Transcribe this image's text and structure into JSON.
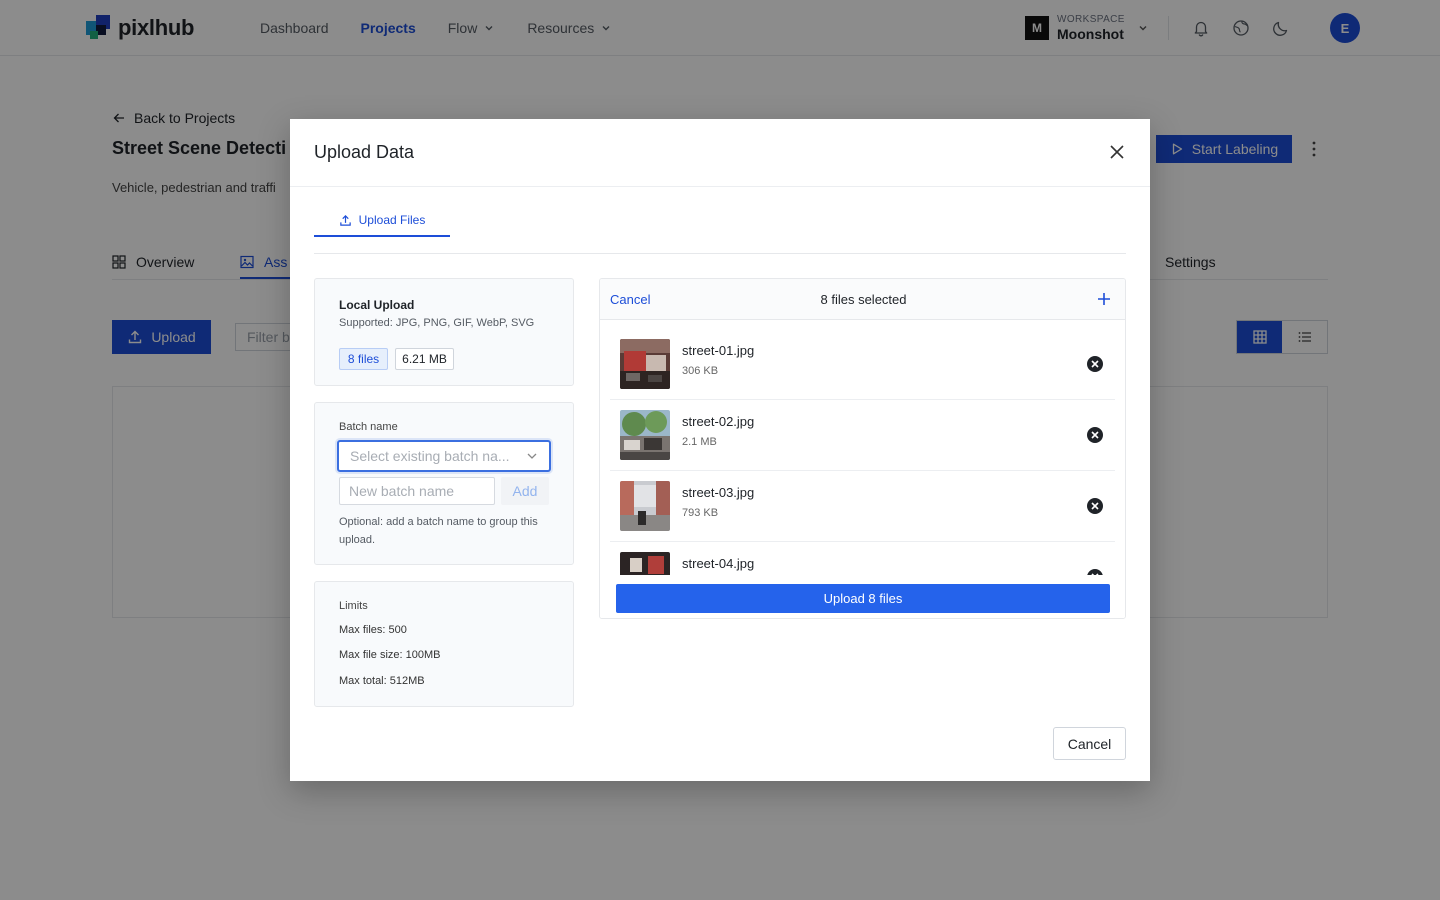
{
  "nav": {
    "brand": "pixlhub",
    "links": [
      {
        "label": "Dashboard"
      },
      {
        "label": "Projects"
      },
      {
        "label": "Flow"
      },
      {
        "label": "Resources"
      }
    ],
    "workspace": {
      "badge": "M",
      "label": "WORKSPACE",
      "name": "Moonshot"
    },
    "icons": [
      "bell-icon",
      "globe-icon",
      "moon-icon"
    ],
    "avatar_initial": "E"
  },
  "page": {
    "back_label": "Back to Projects",
    "title": "Street Scene Detecti",
    "description": "Vehicle, pedestrian and traffi",
    "start_label": "Start Labeling",
    "tabs": {
      "overview": "Overview",
      "assets": "Ass",
      "settings": "Settings"
    },
    "upload_label": "Upload",
    "filter_placeholder": "Filter b"
  },
  "modal": {
    "title": "Upload Data",
    "tab_label": "Upload Files",
    "local": {
      "title": "Local Upload",
      "supported": "Supported: JPG, PNG, GIF, WebP, SVG",
      "files_chip": "8 files",
      "size_chip": "6.21 MB"
    },
    "batch": {
      "label": "Batch name",
      "select_placeholder": "Select existing batch na...",
      "new_placeholder": "New batch name",
      "add_label": "Add",
      "help": "Optional: add a batch name to group this upload."
    },
    "limits": {
      "title": "Limits",
      "max_files": "Max files: 500",
      "max_file_size": "Max file size: 100MB",
      "max_total": "Max total: 512MB"
    },
    "files": {
      "cancel_label": "Cancel",
      "count_label": "8 files selected",
      "items": [
        {
          "name": "street-01.jpg",
          "size": "306 KB"
        },
        {
          "name": "street-02.jpg",
          "size": "2.1 MB"
        },
        {
          "name": "street-03.jpg",
          "size": "793 KB"
        },
        {
          "name": "street-04.jpg",
          "size": ""
        }
      ],
      "upload_label": "Upload 8 files"
    },
    "cancel_label": "Cancel"
  },
  "colors": {
    "accent": "#1d4ed8",
    "primary_button": "#2563eb",
    "overlay": "#000000"
  }
}
